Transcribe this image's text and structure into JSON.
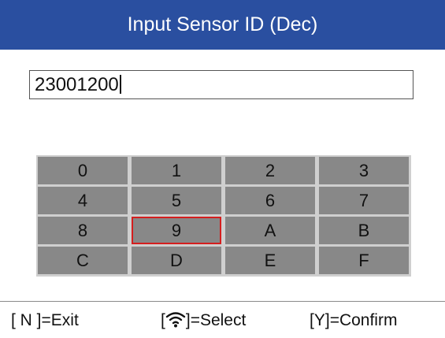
{
  "header": {
    "title": "Input Sensor ID (Dec)"
  },
  "input": {
    "value": "23001200"
  },
  "keypad": {
    "keys": [
      "0",
      "1",
      "2",
      "3",
      "4",
      "5",
      "6",
      "7",
      "8",
      "9",
      "A",
      "B",
      "C",
      "D",
      "E",
      "F"
    ],
    "selected": "9"
  },
  "footer": {
    "exit_prefix": "[ N ]",
    "exit_label": "=Exit",
    "select_open": "[",
    "select_close": "]",
    "select_icon": "wifi-icon",
    "select_label": "=Select",
    "confirm_prefix": "[Y]",
    "confirm_label": "=Confirm"
  },
  "colors": {
    "title_bar": "#2a4fa0",
    "key_fill": "#888888",
    "keypad_bg": "#cfcfcf",
    "selected_border": "#d41e1e"
  }
}
